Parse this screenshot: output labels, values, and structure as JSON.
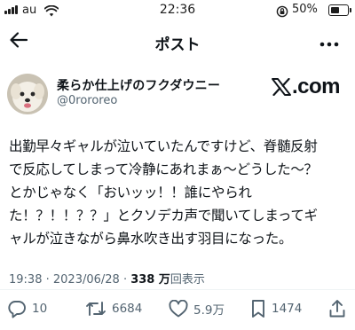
{
  "status_bar": {
    "carrier": "au",
    "time": "22:36",
    "battery_percent": "50%",
    "battery_level": 0.5
  },
  "header": {
    "title": "ポスト",
    "back_icon": "arrow-left-icon",
    "more_icon": "more-horizontal-icon"
  },
  "author": {
    "display_name": "柔らか仕上げのフクダウニー",
    "handle": "@0rororeo",
    "watermark": "X.com"
  },
  "post": {
    "lines": [
      "出勤早々ギャルが泣いていたんですけど、脊髄反射",
      "で反応してしまって冷静にあれまぁ〜どうした〜？",
      "とかじゃなく「おいッッ！！誰にやられ",
      "た！？！！？？」とクソデカ声で聞いてしまってギ",
      "ャルが泣きながら鼻水吹き出す羽目になった。"
    ]
  },
  "meta": {
    "time": "19:38",
    "separator": " · ",
    "date": "2023/06/28",
    "views_count": "338 万",
    "views_label": "回表示"
  },
  "actions": {
    "replies": "10",
    "reposts": "6684",
    "likes": "5.9万",
    "bookmarks": "1474"
  },
  "colors": {
    "text": "#0f1419",
    "secondary": "#536471",
    "divider": "#eff3f4"
  }
}
